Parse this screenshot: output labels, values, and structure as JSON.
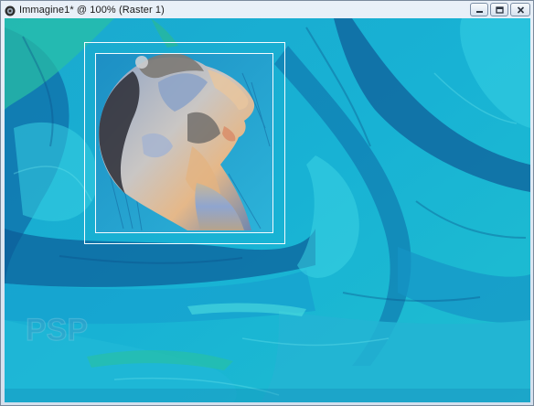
{
  "window": {
    "title": "Immagine1* @ 100% (Raster 1)",
    "controls": [
      "minimize",
      "maximize",
      "close"
    ]
  },
  "icons": {
    "app": "psp-document-icon",
    "minimize": "minimize-icon",
    "maximize": "maximize-icon",
    "close": "close-icon"
  },
  "canvas": {
    "zoom": "100%",
    "layer": "Raster 1",
    "colors": {
      "base": "#16a6cc",
      "light": "#38d3e6",
      "dark": "#0c4f8e",
      "green": "#26c49a",
      "selection": "#f4fbff"
    }
  },
  "watermark": {
    "text": "PSP"
  }
}
